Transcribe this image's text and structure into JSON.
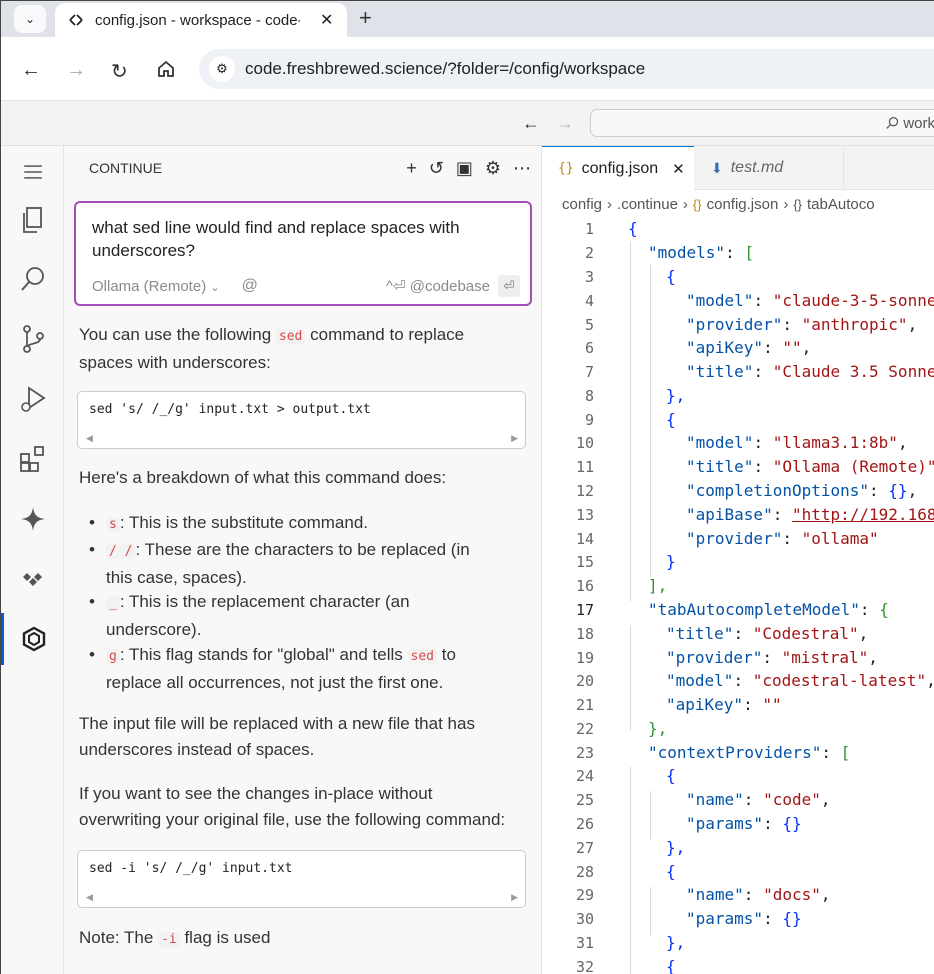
{
  "browser": {
    "tab_title": "config.json - workspace - code-",
    "url": "code.freshbrewed.science/?folder=/config/workspace",
    "tab_icon": "code-server-icon",
    "command_center_text": "work"
  },
  "sidebar": {
    "title": "CONTINUE",
    "input": {
      "question": "what sed line would find and replace spaces with underscores?",
      "model": "Ollama (Remote)",
      "at_symbol": "@",
      "context_hint": "^⏎ @codebase"
    },
    "response": {
      "intro_a": "You can use the following ",
      "intro_code": "sed",
      "intro_b": " command to replace",
      "intro_c": "spaces with underscores:",
      "code1": "sed 's/ /_/g' input.txt > output.txt",
      "breakdown": "Here's a breakdown of what this command does:",
      "b1_code": "s",
      "b1_text": ": This is the substitute command.",
      "b2_code": "/ /",
      "b2_text_a": ": These are the characters to be replaced (in",
      "b2_text_b": "this case, spaces).",
      "b3_code": "_",
      "b3_text_a": ": This is the replacement character (an",
      "b3_text_b": "underscore).",
      "b4_code": "g",
      "b4_text_a": ": This flag stands for \"global\" and tells ",
      "b4_code2": "sed",
      "b4_text_b": " to",
      "b4_text_c": "replace all occurrences, not just the first one.",
      "p2_a": "The input file will be replaced with a new file that has",
      "p2_b": "underscores instead of spaces.",
      "p3_a": "If you want to see the changes in-place without",
      "p3_b": "overwriting your original file, use the following command:",
      "code2": "sed -i 's/ /_/g' input.txt",
      "note_a": "Note: The ",
      "note_code": "-i",
      "note_b": " flag is used"
    }
  },
  "editor": {
    "tab1": "config.json",
    "tab2": "test.md",
    "breadcrumbs": [
      "config",
      ".continue",
      "config.json",
      "tabAutoco"
    ],
    "line_numbers": [
      "1",
      "2",
      "3",
      "4",
      "5",
      "6",
      "7",
      "8",
      "9",
      "10",
      "11",
      "12",
      "13",
      "14",
      "15",
      "16",
      "17",
      "18",
      "19",
      "20",
      "21",
      "22",
      "23",
      "24",
      "25",
      "26",
      "27",
      "28",
      "29",
      "30",
      "31",
      "32"
    ],
    "code_text": {
      "l1": "{",
      "l2_key": "\"models\"",
      "l2_rest": ": ",
      "l2_b": "[",
      "l3": "{",
      "l4_key": "\"model\"",
      "l4_val": "\"claude-3-5-sonne",
      "l5_key": "\"provider\"",
      "l5_val": "\"anthropic\"",
      "l6_key": "\"apiKey\"",
      "l6_val": "\"\"",
      "l7_key": "\"title\"",
      "l7_val": "\"Claude 3.5 Sonne",
      "l8": "},",
      "l9": "{",
      "l10_key": "\"model\"",
      "l10_val": "\"llama3.1:8b\"",
      "l11_key": "\"title\"",
      "l11_val": "\"Ollama (Remote)\"",
      "l12_key": "\"completionOptions\"",
      "l12_val": "{}",
      "l13_key": "\"apiBase\"",
      "l13_val": "\"http://192.168",
      "l14_key": "\"provider\"",
      "l14_val": "\"ollama\"",
      "l15": "}",
      "l16": "],",
      "l17_key": "\"tabAutocompleteModel\"",
      "l17_b": "{",
      "l18_key": "\"title\"",
      "l18_val": "\"Codestral\"",
      "l19_key": "\"provider\"",
      "l19_val": "\"mistral\"",
      "l20_key": "\"model\"",
      "l20_val": "\"codestral-latest\"",
      "l21_key": "\"apiKey\"",
      "l21_val": "\"\"",
      "l22": "},",
      "l23_key": "\"contextProviders\"",
      "l23_b": "[",
      "l24": "{",
      "l25_key": "\"name\"",
      "l25_val": "\"code\"",
      "l26_key": "\"params\"",
      "l26_val": "{}",
      "l27": "},",
      "l28": "{",
      "l29_key": "\"name\"",
      "l29_val": "\"docs\"",
      "l30_key": "\"params\"",
      "l30_val": "{}",
      "l31": "},",
      "l32": "{"
    }
  }
}
